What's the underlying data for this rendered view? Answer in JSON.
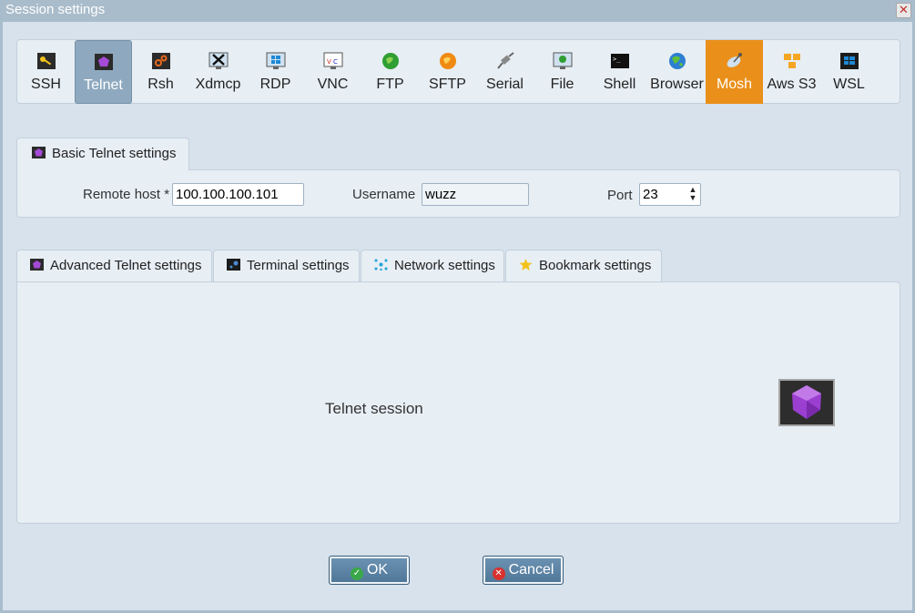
{
  "window": {
    "title": "Session settings",
    "close": "✕"
  },
  "toolbar": {
    "items": [
      {
        "label": "SSH",
        "icon": "key-icon"
      },
      {
        "label": "Telnet",
        "icon": "gem-icon"
      },
      {
        "label": "Rsh",
        "icon": "rsh-icon"
      },
      {
        "label": "Xdmcp",
        "icon": "x-display-icon"
      },
      {
        "label": "RDP",
        "icon": "windows-monitor-icon"
      },
      {
        "label": "VNC",
        "icon": "vnc-icon"
      },
      {
        "label": "FTP",
        "icon": "ftp-globe-icon"
      },
      {
        "label": "SFTP",
        "icon": "sftp-globe-icon"
      },
      {
        "label": "Serial",
        "icon": "serial-plug-icon"
      },
      {
        "label": "File",
        "icon": "file-monitor-icon"
      },
      {
        "label": "Shell",
        "icon": "terminal-icon"
      },
      {
        "label": "Browser",
        "icon": "globe-icon"
      },
      {
        "label": "Mosh",
        "icon": "satellite-icon"
      },
      {
        "label": "Aws S3",
        "icon": "aws-cubes-icon"
      },
      {
        "label": "WSL",
        "icon": "windows-logo-icon"
      }
    ],
    "selected": "Telnet",
    "highlighted": "Mosh"
  },
  "basic": {
    "tab_label": "Basic Telnet settings",
    "remote_host_label": "Remote host *",
    "remote_host_value": "100.100.100.101",
    "username_label": "Username",
    "username_value": "wuzz",
    "port_label": "Port",
    "port_value": "23"
  },
  "tabs": [
    {
      "label": "Advanced Telnet settings",
      "icon": "gem-icon"
    },
    {
      "label": "Terminal settings",
      "icon": "terminal-settings-icon"
    },
    {
      "label": "Network settings",
      "icon": "network-icon"
    },
    {
      "label": "Bookmark settings",
      "icon": "star-icon"
    }
  ],
  "content": {
    "session_label": "Telnet session"
  },
  "buttons": {
    "ok": "OK",
    "cancel": "Cancel"
  },
  "colors": {
    "accent": "#ea8f19",
    "selected": "#8ea9bf",
    "button": "#5b84a6"
  }
}
